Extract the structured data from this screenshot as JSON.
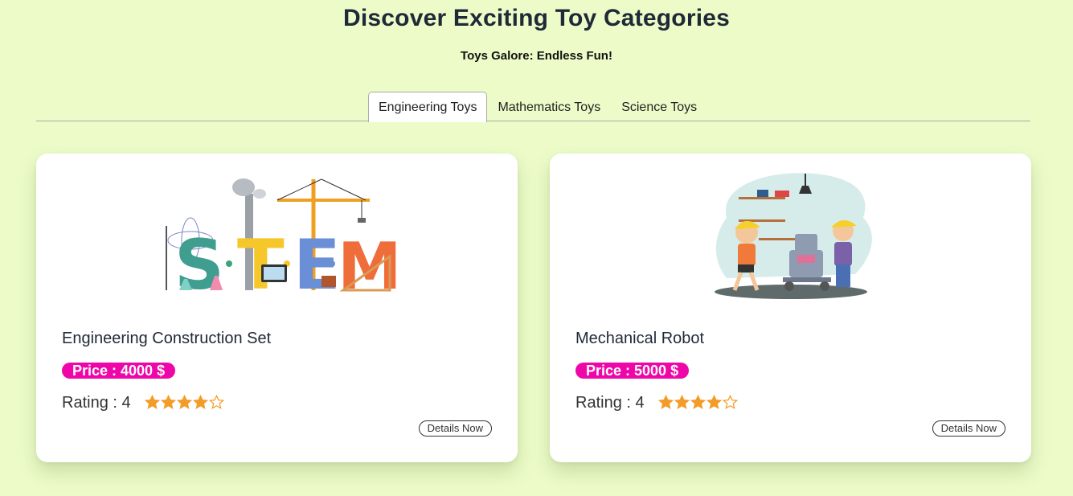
{
  "header": {
    "title": "Discover Exciting Toy Categories",
    "subtitle": "Toys Galore: Endless Fun!"
  },
  "tabs": [
    {
      "label": "Engineering Toys",
      "active": true
    },
    {
      "label": "Mathematics Toys",
      "active": false
    },
    {
      "label": "Science Toys",
      "active": false
    }
  ],
  "products": [
    {
      "name": "Engineering Construction Set",
      "price_label": "Price : 4000 $",
      "rating_label": "Rating : 4",
      "rating": 4,
      "rating_max": 5,
      "details_label": "Details Now",
      "image": "stem-letters-illustration"
    },
    {
      "name": "Mechanical Robot",
      "price_label": "Price : 5000 $",
      "rating_label": "Rating : 4",
      "rating": 4,
      "rating_max": 5,
      "details_label": "Details Now",
      "image": "kids-building-robot-illustration"
    }
  ],
  "colors": {
    "background": "#ecfbc8",
    "price_badge": "#ee06a8",
    "star": "#f39c2a"
  }
}
